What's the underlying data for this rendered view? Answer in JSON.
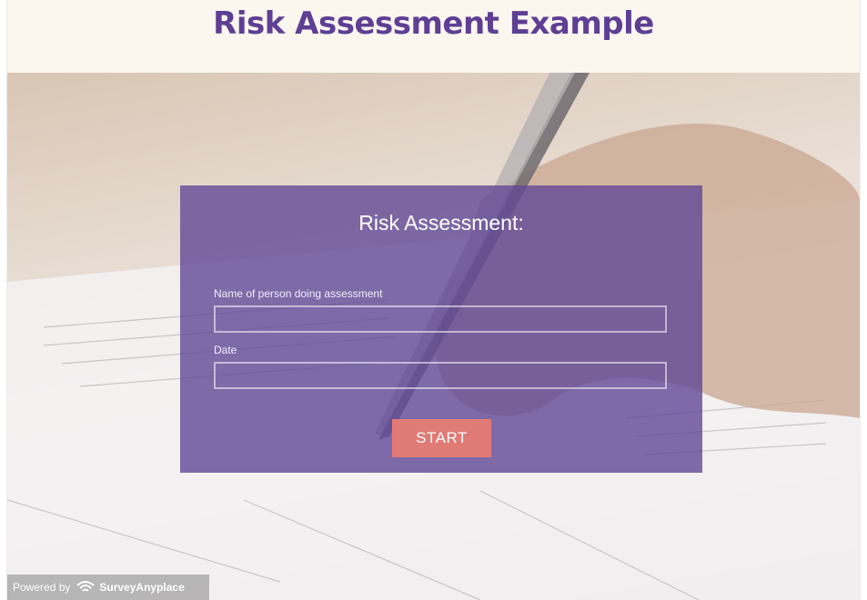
{
  "header": {
    "title": "Risk Assessment Example"
  },
  "form": {
    "title": "Risk Assessment:",
    "fields": [
      {
        "label": "Name of person doing assessment",
        "value": ""
      },
      {
        "label": "Date",
        "value": ""
      }
    ],
    "start_label": "START"
  },
  "footer": {
    "powered_prefix": "Powered by",
    "brand": "SurveyAnyplace",
    "icon": "wifi-logo-icon"
  },
  "colors": {
    "title": "#5e3f94",
    "panel": "#624896",
    "start_button": "#e07a74",
    "header_bg": "#fbf6ee"
  }
}
